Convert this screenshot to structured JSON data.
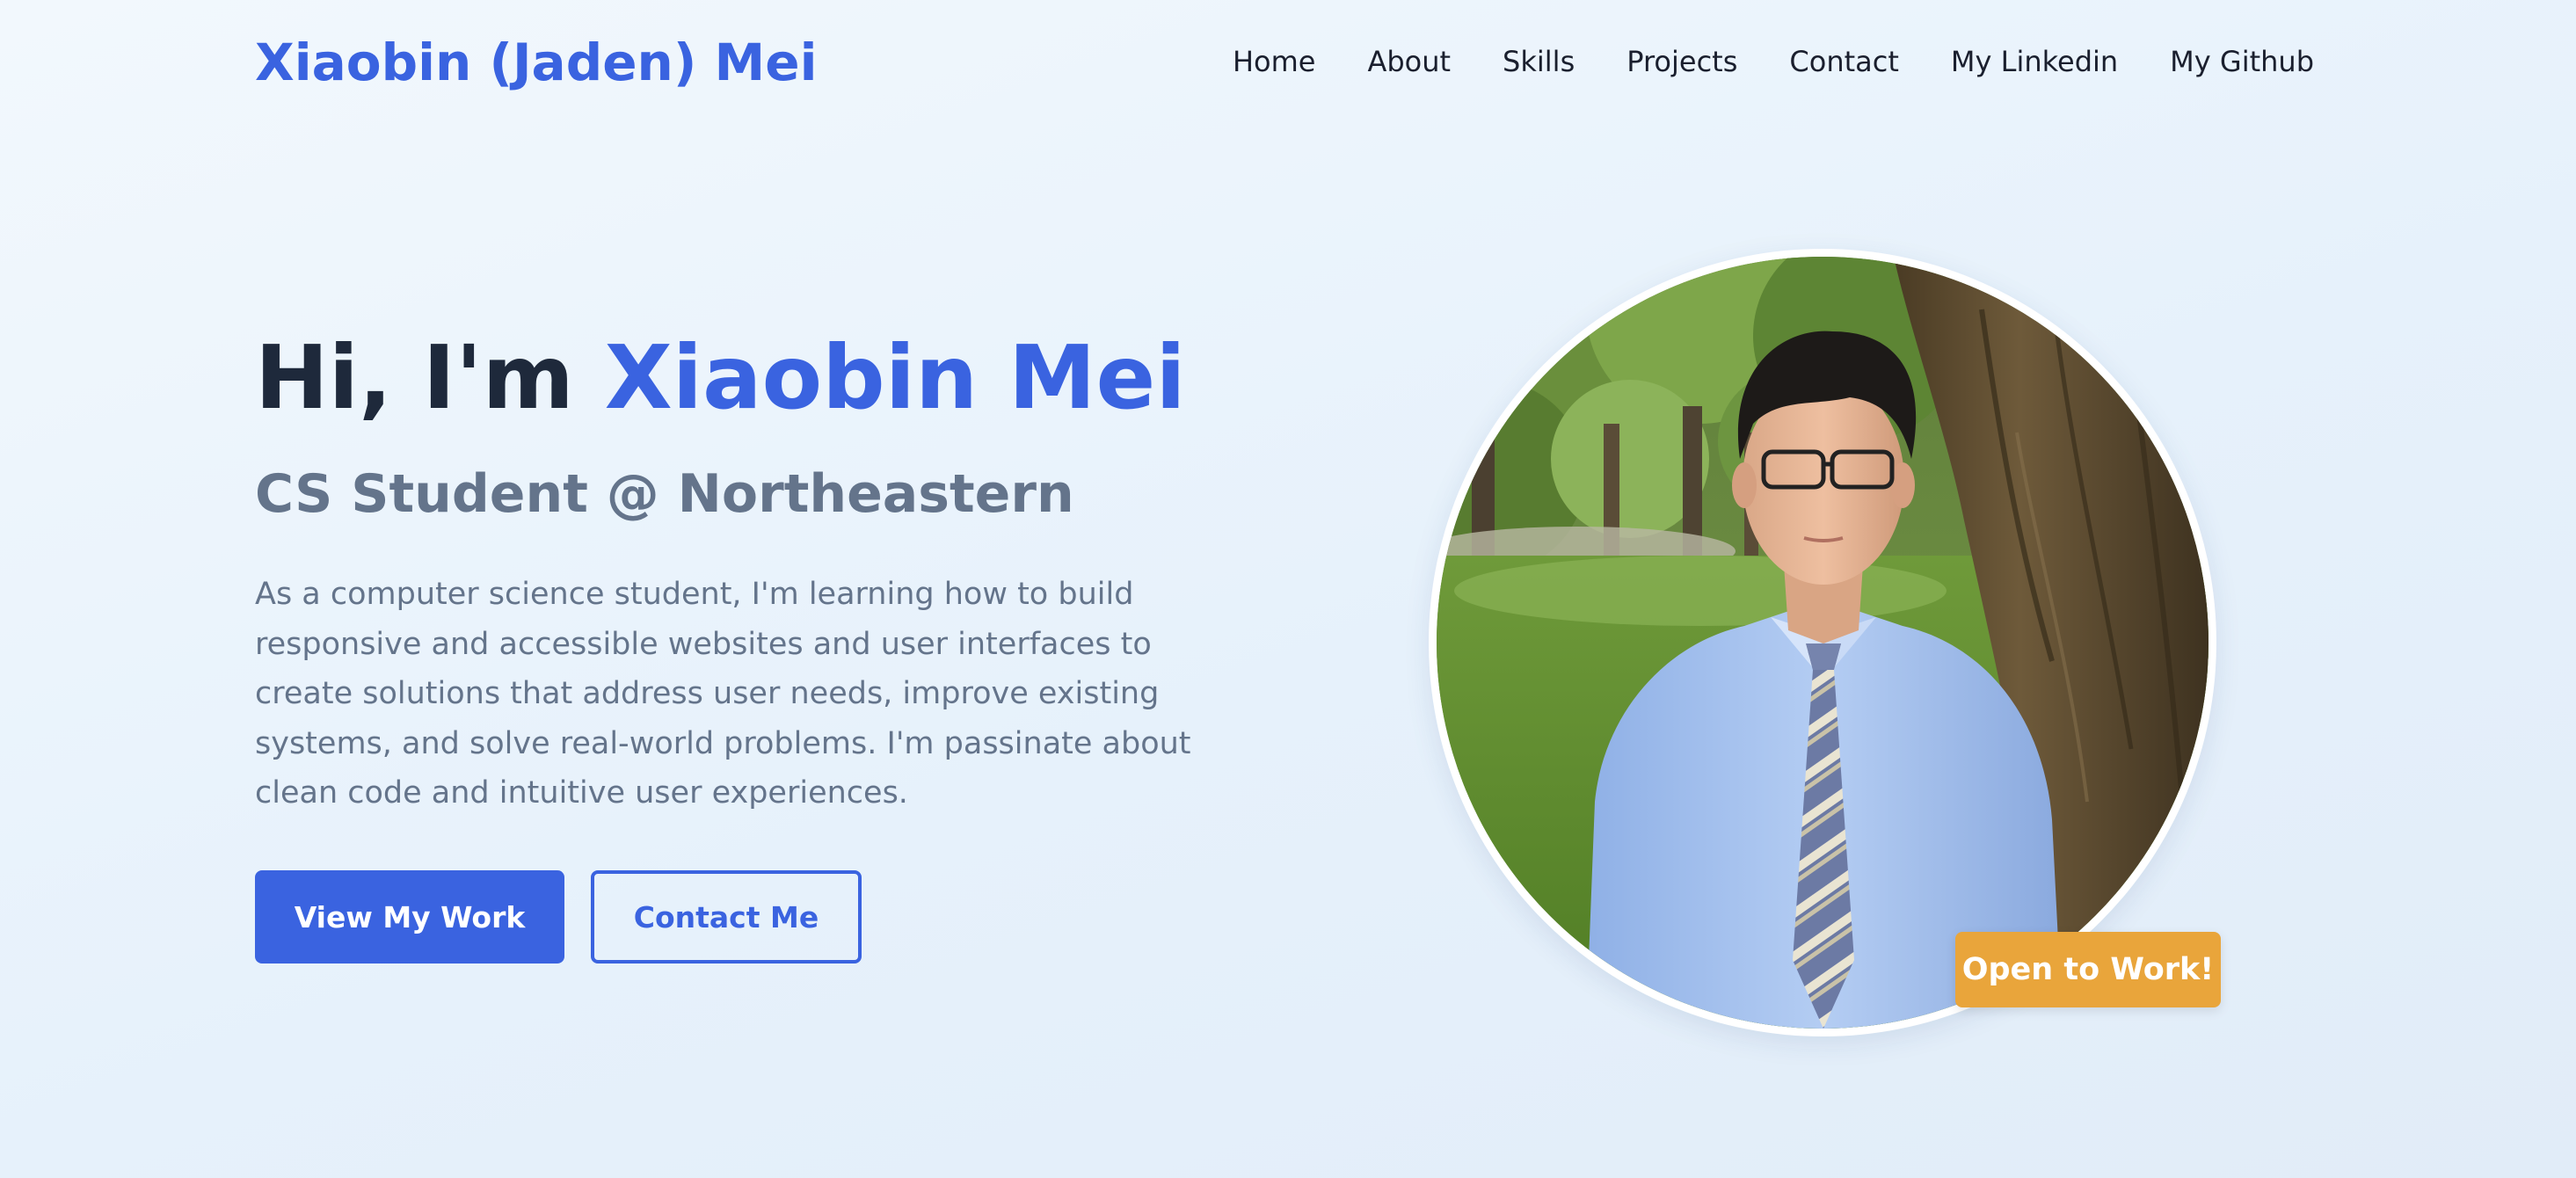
{
  "header": {
    "brand": "Xiaobin (Jaden) Mei",
    "nav": [
      {
        "label": "Home"
      },
      {
        "label": "About"
      },
      {
        "label": "Skills"
      },
      {
        "label": "Projects"
      },
      {
        "label": "Contact"
      },
      {
        "label": "My Linkedin"
      },
      {
        "label": "My Github"
      }
    ]
  },
  "hero": {
    "greeting": "Hi, I'm ",
    "name": "Xiaobin Mei",
    "subtitle": "CS Student @ Northeastern",
    "description": "As a computer science student, I'm learning how to build responsive and accessible websites and user interfaces to create solutions that address user needs, improve existing systems, and solve real-world problems. I'm passinate about clean code and intuitive user experiences.",
    "primary_button": "View My Work",
    "secondary_button": "Contact Me"
  },
  "profile": {
    "badge": "Open to Work!"
  },
  "colors": {
    "accent": "#3a63e0",
    "heading": "#1e293b",
    "muted": "#64748b",
    "badge": "#e9a53b",
    "background": "#eaf3fb"
  }
}
